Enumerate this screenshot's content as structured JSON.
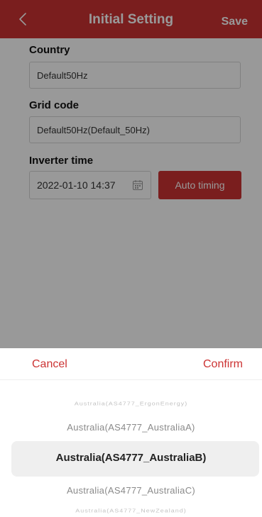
{
  "header": {
    "title": "Initial Setting",
    "back_icon": "chevron-left-icon",
    "save_label": "Save"
  },
  "form": {
    "country": {
      "label": "Country",
      "value": "Default50Hz"
    },
    "grid_code": {
      "label": "Grid code",
      "value": "Default50Hz(Default_50Hz)"
    },
    "inverter_time": {
      "label": "Inverter time",
      "value": "2022-01-10 14:37",
      "icon": "calendar-icon",
      "auto_timing_label": "Auto timing"
    }
  },
  "picker": {
    "cancel_label": "Cancel",
    "confirm_label": "Confirm",
    "selected_index": 2,
    "options": [
      "Australia(AS4777_ErgonEnergy)",
      "Australia(AS4777_AustraliaA)",
      "Australia(AS4777_AustraliaB)",
      "Australia(AS4777_AustraliaC)",
      "Australia(AS4777_NewZealand)"
    ]
  },
  "colors": {
    "accent": "#cc3333",
    "overlay": "rgba(0,0,0,0.40)",
    "selected_row_bg": "#efefef"
  }
}
